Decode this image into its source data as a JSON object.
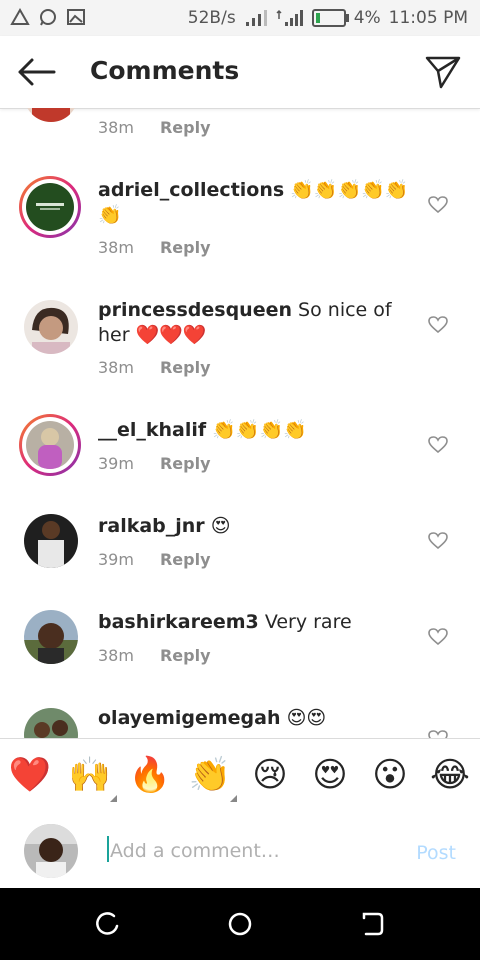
{
  "status": {
    "speed": "52B/s",
    "battery": "4%",
    "time": "11:05 PM"
  },
  "header": {
    "title": "Comments"
  },
  "comments": [
    {
      "username": "",
      "text": "",
      "emoji": "",
      "time": "38m",
      "reply": "Reply"
    },
    {
      "username": "adriel_collections",
      "text": "",
      "emoji": "👏👏👏👏👏👏",
      "time": "38m",
      "reply": "Reply"
    },
    {
      "username": "princessdesqueen",
      "text": "So nice of her",
      "emoji": "❤️❤️❤️",
      "time": "38m",
      "reply": "Reply"
    },
    {
      "username": "__el_khalif",
      "text": "",
      "emoji": "👏👏👏👏",
      "time": "39m",
      "reply": "Reply"
    },
    {
      "username": "ralkab_jnr",
      "text": "",
      "emoji": "😍",
      "time": "39m",
      "reply": "Reply"
    },
    {
      "username": "bashirkareem3",
      "text": "Very rare",
      "emoji": "",
      "time": "38m",
      "reply": "Reply"
    },
    {
      "username": "olayemigemegah",
      "text": "",
      "emoji": "😍😍",
      "time": "",
      "reply": ""
    }
  ],
  "reactions": [
    "❤️",
    "🙌",
    "🔥",
    "👏",
    "😢",
    "😍",
    "😮",
    "😂"
  ],
  "composer": {
    "placeholder": "Add a comment…",
    "post_label": "Post"
  },
  "colors": {
    "accent_disabled": "#b3dbff",
    "meta_gray": "#8e8e8e"
  }
}
